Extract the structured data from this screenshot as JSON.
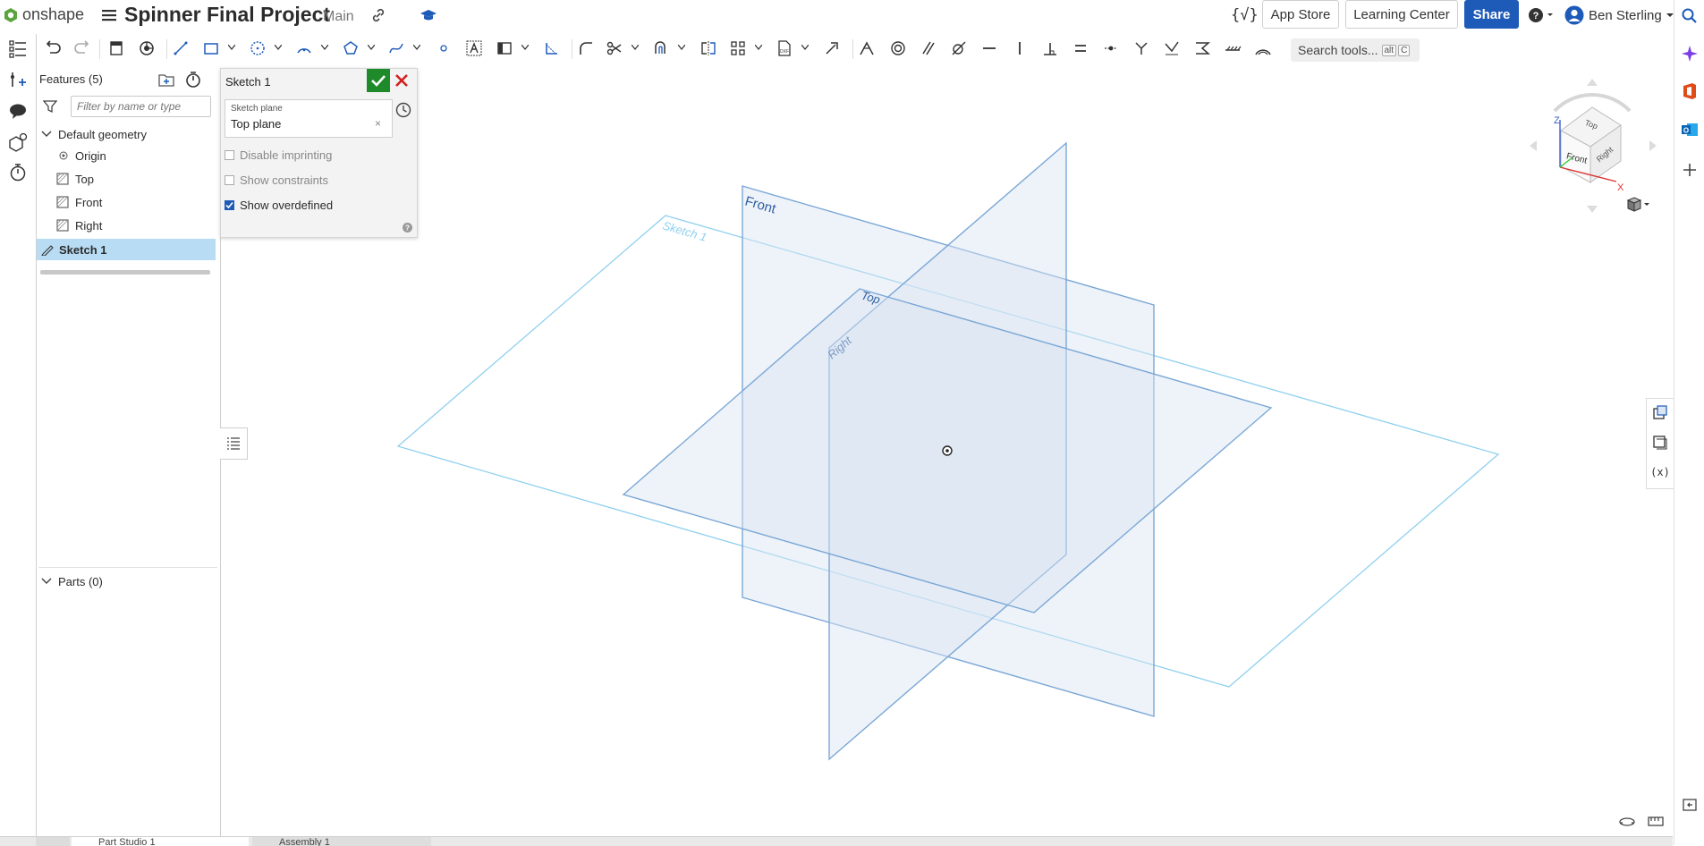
{
  "app": {
    "logo_text": "onshape",
    "document_title": "Spinner Final Project",
    "branch": "Main"
  },
  "header": {
    "fx_label": "{√}",
    "app_store": "App Store",
    "learning_center": "Learning Center",
    "share": "Share",
    "user_name": "Ben Sterling",
    "accent_color": "#1e5bb8"
  },
  "toolbar": {
    "search_placeholder": "Search tools...",
    "search_shortcut_1": "alt",
    "search_shortcut_2": "C"
  },
  "feature_panel": {
    "title": "Features (5)",
    "filter_placeholder": "Filter by name or type",
    "group_label": "Default geometry",
    "items": [
      {
        "label": "Origin",
        "icon": "origin-icon"
      },
      {
        "label": "Top",
        "icon": "plane-icon"
      },
      {
        "label": "Front",
        "icon": "plane-icon"
      },
      {
        "label": "Right",
        "icon": "plane-icon"
      }
    ],
    "selected_item": "Sketch 1",
    "parts_label": "Parts (0)"
  },
  "sketch_dialog": {
    "title": "Sketch 1",
    "plane_label": "Sketch plane",
    "plane_value": "Top plane",
    "clear_glyph": "×",
    "disable_imprinting": "Disable imprinting",
    "show_constraints": "Show constraints",
    "show_overdefined": "Show overdefined",
    "disable_imprinting_checked": false,
    "show_constraints_checked": false,
    "show_overdefined_checked": true
  },
  "viewport": {
    "labels": {
      "front": "Front",
      "top": "Top",
      "right": "Right",
      "sketch": "Sketch 1"
    },
    "plane_color": "#7aa7d6",
    "sketch_color": "#8fd0ef"
  },
  "viewcube": {
    "z": "Z",
    "x": "X",
    "top": "Top",
    "front": "Front",
    "right": "Right"
  },
  "bottom_tabs": {
    "tab1": "Part Studio 1",
    "tab2": "Assembly 1"
  }
}
